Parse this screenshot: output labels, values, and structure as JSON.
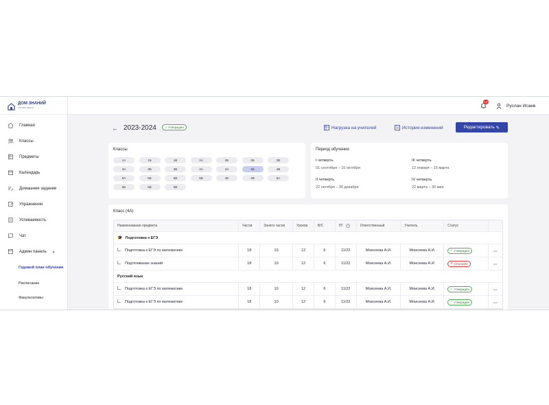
{
  "brand": {
    "name": "ДОМ ЗНАНИЙ",
    "sub": "онлайн школа"
  },
  "header": {
    "notifications_count": "13",
    "user_name": "Руслан Исаев"
  },
  "sidebar": {
    "items": [
      {
        "label": "Главная",
        "icon": "home-icon"
      },
      {
        "label": "Классы",
        "icon": "users-icon"
      },
      {
        "label": "Предметы",
        "icon": "book-icon"
      },
      {
        "label": "Календарь",
        "icon": "calendar-icon"
      },
      {
        "label": "Домашние задание",
        "icon": "homework-icon"
      },
      {
        "label": "Упражнения",
        "icon": "exercise-icon"
      },
      {
        "label": "Успеваемость",
        "icon": "progress-icon"
      },
      {
        "label": "Чат",
        "icon": "chat-icon"
      },
      {
        "label": "Админ панель",
        "icon": "admin-icon"
      }
    ],
    "sub_items": [
      {
        "label": "Годовой план обучения",
        "active": true
      },
      {
        "label": "Расписание",
        "active": false
      },
      {
        "label": "Факультативы",
        "active": false
      }
    ]
  },
  "page": {
    "year": "2023-2024",
    "status": "Утверждён",
    "teachers_load": "Нагрузка на учителей",
    "history": "История изменений",
    "edit": "Редактировать"
  },
  "classes": {
    "title": "Классы",
    "items": [
      "1А",
      "1Б",
      "1В",
      "2А",
      "2Б",
      "2Б",
      "2В",
      "3А",
      "3Б",
      "3В",
      "4А",
      "4А",
      "4Б",
      "4В",
      "5А",
      "5Б",
      "5В",
      "5В",
      "4Б",
      "4В",
      "5А",
      "5Б",
      "5Б",
      "5В"
    ],
    "selected": "4Б"
  },
  "period": {
    "title": "Период обучения",
    "quarters": [
      {
        "name": "I четверть",
        "dates": "01 сентября – 15 октября"
      },
      {
        "name": "III четверть",
        "dates": "12 января – 15 марта"
      },
      {
        "name": "II четверть",
        "dates": "22 октября – 30 декабря"
      },
      {
        "name": "IV четверть",
        "dates": "22 марта – 30 мая"
      }
    ]
  },
  "table": {
    "title": "Класс (4А)",
    "columns": [
      "Наименование предмета",
      "Часов",
      "Занято часов",
      "Уроков",
      "В/С",
      "ПГ",
      "Ответственный",
      "Учитель",
      "Статус"
    ],
    "groups": [
      {
        "name": "Подготовка к ЕГЭ",
        "rows": [
          {
            "name": "Подготовка к ЕГЭ по математике",
            "hours": "18",
            "busy": "10",
            "lessons": "12",
            "vs": "6",
            "pg": "11/22",
            "responsible": "Моисеева А.И.",
            "teacher": "Моисеева А.И.",
            "status": "Утверждён",
            "ok": true
          },
          {
            "name": "Подтягивание знаний",
            "hours": "18",
            "busy": "10",
            "lessons": "12",
            "vs": "6",
            "pg": "11/22",
            "responsible": "Моисеева А.И.",
            "teacher": "Моисеева А.И.",
            "status": "Отклонён",
            "ok": false
          }
        ]
      },
      {
        "name": "Русский язык",
        "rows": [
          {
            "name": "Подготовка к ЕГЭ по математике",
            "hours": "18",
            "busy": "10",
            "lessons": "12",
            "vs": "6",
            "pg": "11/22",
            "responsible": "Моисеева А.И.",
            "teacher": "Моисеева А.И.",
            "status": "Утверждён",
            "ok": true
          },
          {
            "name": "Подготовка к ЕГЭ по математике",
            "hours": "18",
            "busy": "10",
            "lessons": "12",
            "vs": "6",
            "pg": "11/22",
            "responsible": "Моисеева А.И.",
            "teacher": "Моисеева А.И.",
            "status": "Утверждён",
            "ok": true
          }
        ]
      }
    ]
  },
  "colors": {
    "accent": "#3346a8",
    "ok": "#4caf50",
    "bad": "#e53935"
  }
}
